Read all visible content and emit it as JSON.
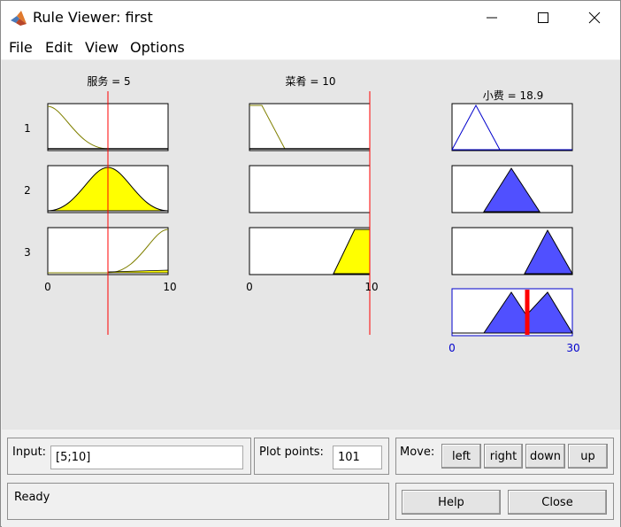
{
  "window": {
    "title": "Rule Viewer: first",
    "controls": [
      "minimize",
      "maximize",
      "close"
    ]
  },
  "menu": [
    "File",
    "Edit",
    "View",
    "Options"
  ],
  "inputs": [
    {
      "name": "服务",
      "value": 5,
      "header": "服务 = 5",
      "range": [
        0,
        10
      ],
      "tick_min": "0",
      "tick_max": "10"
    },
    {
      "name": "菜肴",
      "value": 10,
      "header": "菜肴 = 10",
      "range": [
        0,
        10
      ],
      "tick_min": "0",
      "tick_max": "10"
    }
  ],
  "output": {
    "name": "小费",
    "value": 18.9,
    "header": "小费 = 18.9",
    "range": [
      0,
      30
    ],
    "tick_min": "0",
    "tick_max": "30"
  },
  "rules": [
    "1",
    "2",
    "3"
  ],
  "colors": {
    "input_fill": "#ffff00",
    "output_fill": "#5050ff",
    "curve": "#808000",
    "indicator": "#ff0000",
    "axis_blue": "#0000cc"
  },
  "bottom": {
    "input_label": "Input:",
    "input_value": "[5;10]",
    "plot_points_label": "Plot points:",
    "plot_points_value": "101",
    "move_label": "Move:",
    "move_buttons": [
      "left",
      "right",
      "down",
      "up"
    ],
    "status": "Ready",
    "help_label": "Help",
    "close_label": "Close"
  }
}
